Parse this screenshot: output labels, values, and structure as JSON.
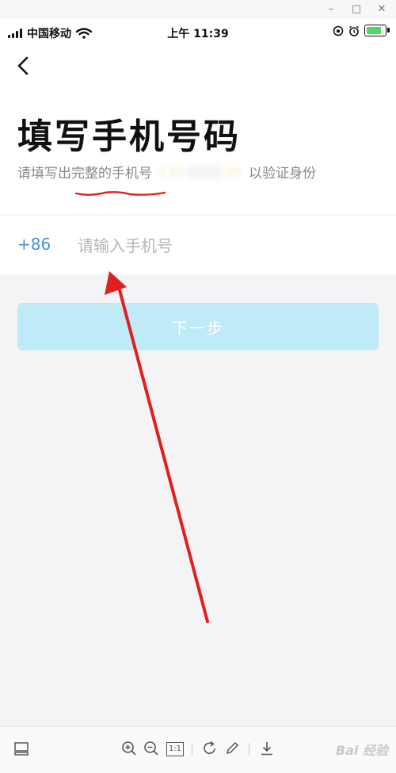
{
  "status_bar": {
    "carrier": "中国移动",
    "time": "上午 11:39"
  },
  "page": {
    "title": "填写手机号码",
    "subtitle_prefix": "请填写出完整的手机号",
    "masked_start": "135",
    "masked_end": "05",
    "subtitle_suffix": "以验证身份"
  },
  "form": {
    "country_code": "+86",
    "phone_placeholder": "请输入手机号",
    "phone_value": ""
  },
  "actions": {
    "next_label": "下一步"
  },
  "viewer": {
    "page_box_label": "1:1",
    "watermark": "Bai 经验"
  },
  "colors": {
    "accent_blue": "#4a90d9",
    "button_disabled": "#bfeaf8",
    "annotation_red": "#e02020"
  }
}
